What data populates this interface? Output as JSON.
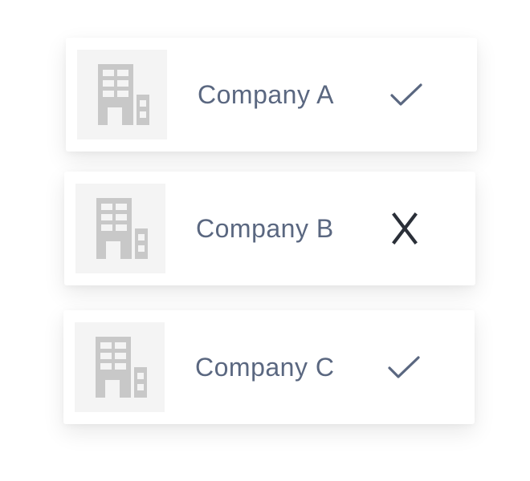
{
  "companies": [
    {
      "name": "Company A",
      "status": "approved",
      "status_icon": "check-icon"
    },
    {
      "name": "Company B",
      "status": "rejected",
      "status_icon": "x-icon"
    },
    {
      "name": "Company C",
      "status": "approved",
      "status_icon": "check-icon"
    }
  ],
  "colors": {
    "text": "#5a6780",
    "check": "#5a6780",
    "x": "#2a2f38",
    "logo_bg": "#f4f4f4",
    "building": "#c8c8c8"
  }
}
